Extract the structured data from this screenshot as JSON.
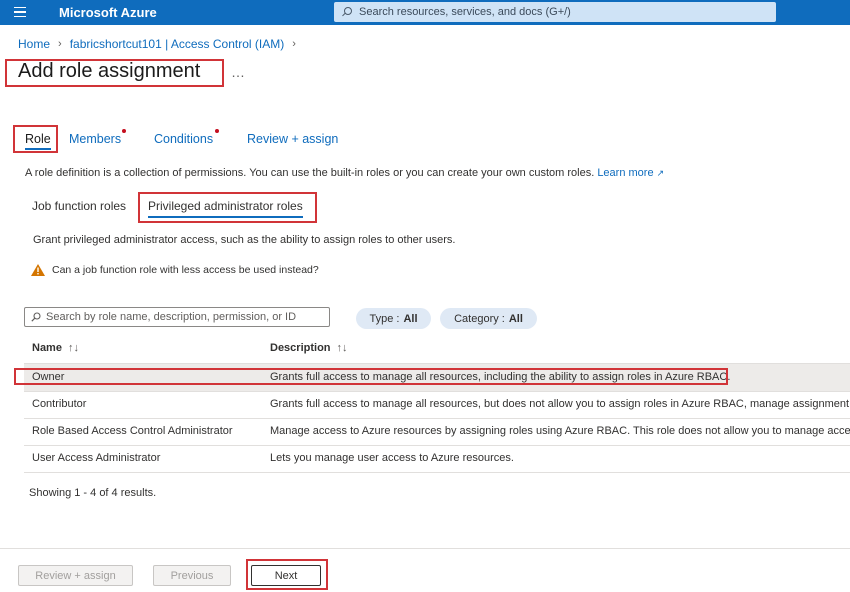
{
  "header": {
    "brand": "Microsoft Azure",
    "search_placeholder": "Search resources, services, and docs (G+/)"
  },
  "breadcrumb": {
    "items": [
      "Home",
      "fabricshortcut101 | Access Control (IAM)"
    ]
  },
  "page": {
    "title": "Add role assignment",
    "more": "…"
  },
  "tabs": [
    {
      "label": "Role",
      "active": true
    },
    {
      "label": "Members",
      "required": true
    },
    {
      "label": "Conditions",
      "required": true
    },
    {
      "label": "Review + assign"
    }
  ],
  "description": {
    "text": "A role definition is a collection of permissions. You can use the built-in roles or you can create your own custom roles.",
    "link": "Learn more"
  },
  "subtabs": [
    {
      "label": "Job function roles"
    },
    {
      "label": "Privileged administrator roles",
      "active": true
    }
  ],
  "grant_text": "Grant privileged administrator access, such as the ability to assign roles to other users.",
  "warning_text": "Can a job function role with less access be used instead?",
  "filters": {
    "search_placeholder": "Search by role name, description, permission, or ID",
    "type_label": "Type :",
    "type_value": "All",
    "category_label": "Category :",
    "category_value": "All"
  },
  "table": {
    "columns": [
      "Name",
      "Description"
    ],
    "sort_glyph": "↑↓",
    "rows": [
      {
        "name": "Owner",
        "description": "Grants full access to manage all resources, including the ability to assign roles in Azure RBAC.",
        "selected": true
      },
      {
        "name": "Contributor",
        "description": "Grants full access to manage all resources, but does not allow you to assign roles in Azure RBAC, manage assignment..."
      },
      {
        "name": "Role Based Access Control Administrator",
        "description": "Manage access to Azure resources by assigning roles using Azure RBAC. This role does not allow you to manage acce..."
      },
      {
        "name": "User Access Administrator",
        "description": "Lets you manage user access to Azure resources."
      }
    ]
  },
  "showing": "Showing 1 - 4 of 4 results.",
  "footer": {
    "review_assign": "Review + assign",
    "previous": "Previous",
    "next": "Next"
  },
  "colors": {
    "accent": "#0f6cbd",
    "highlight_box": "#d13438",
    "required_dot": "#c50f1f",
    "warning": "#d47500"
  }
}
